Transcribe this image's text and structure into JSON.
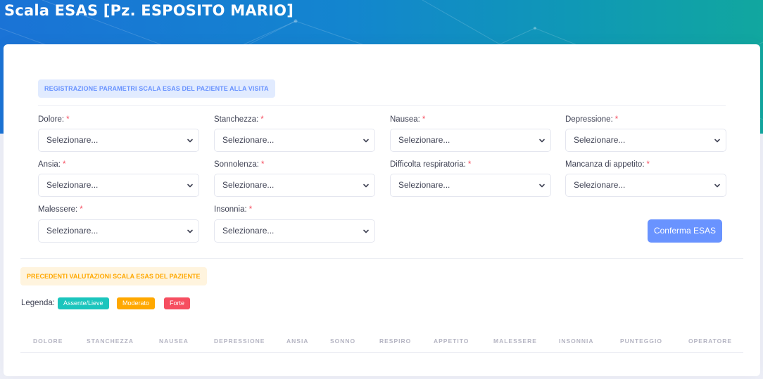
{
  "header": {
    "title": "Scala ESAS [Pz. ESPOSITO MARIO]"
  },
  "form": {
    "section_title": "REGISTRAZIONE PARAMETRI SCALA ESAS DEL PAZIENTE ALLA VISITA",
    "required_marker": "*",
    "fields": [
      {
        "label": "Dolore:",
        "value": "Selezionare..."
      },
      {
        "label": "Stanchezza:",
        "value": "Selezionare..."
      },
      {
        "label": "Nausea:",
        "value": "Selezionare..."
      },
      {
        "label": "Depressione:",
        "value": "Selezionare..."
      },
      {
        "label": "Ansia:",
        "value": "Selezionare..."
      },
      {
        "label": "Sonnolenza:",
        "value": "Selezionare..."
      },
      {
        "label": "Difficolta respiratoria:",
        "value": "Selezionare..."
      },
      {
        "label": "Mancanza di appetito:",
        "value": "Selezionare..."
      },
      {
        "label": "Malessere:",
        "value": "Selezionare..."
      },
      {
        "label": "Insonnia:",
        "value": "Selezionare..."
      }
    ],
    "confirm_label": "Conferma ESAS"
  },
  "history": {
    "section_title": "PRECEDENTI VALUTAZIONI SCALA ESAS DEL PAZIENTE",
    "legend_label": "Legenda:",
    "legend": [
      {
        "label": "Assente/Lieve",
        "color": "#1bc5bd"
      },
      {
        "label": "Moderato",
        "color": "#ffa800"
      },
      {
        "label": "Forte",
        "color": "#f64e60"
      }
    ],
    "columns": [
      "DOLORE",
      "STANCHEZZA",
      "NAUSEA",
      "DEPRESSIONE",
      "ANSIA",
      "SONNO",
      "RESPIRO",
      "APPETITO",
      "MALESSERE",
      "INSONNIA",
      "PUNTEGGIO",
      "OPERATORE"
    ]
  },
  "colors": {
    "primary": "#6993ff",
    "primary_light": "#e1ebff",
    "warning": "#ffa800",
    "warning_light": "#fff4de",
    "danger": "#f64e60",
    "success": "#1bc5bd"
  }
}
